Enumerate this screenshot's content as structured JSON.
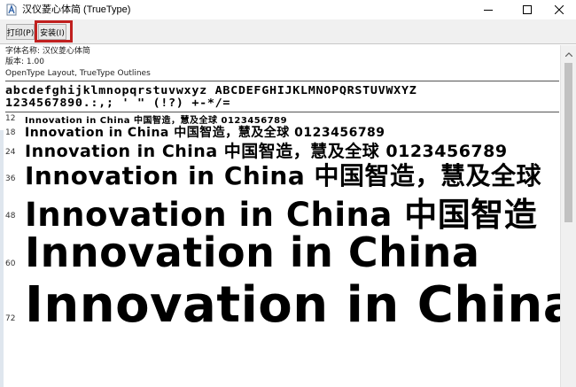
{
  "window": {
    "title": "汉仪菱心体简 (TrueType)",
    "icons": {
      "app": "font-file-icon",
      "minimize": "minimize-icon",
      "maximize": "maximize-icon",
      "close": "close-icon"
    }
  },
  "toolbar": {
    "print_label": "打印(P)",
    "install_label": "安装(I)",
    "highlight_color": "#c0201f"
  },
  "info": {
    "font_name": "字体名称: 汉仪菱心体简",
    "version": "版本: 1.00",
    "outline": "OpenType Layout, TrueType Outlines"
  },
  "charset": {
    "line1": "abcdefghijklmnopqrstuvwxyz ABCDEFGHIJKLMNOPQRSTUVWXYZ",
    "line2": "1234567890.:,; ' \" (!?) +-*/="
  },
  "samples": [
    {
      "size": "12",
      "text": "Innovation in China 中国智造，慧及全球 0123456789"
    },
    {
      "size": "18",
      "text": "Innovation in China 中国智造，慧及全球 0123456789"
    },
    {
      "size": "24",
      "text": "Innovation in China 中国智造，慧及全球 0123456789"
    },
    {
      "size": "36",
      "text": "Innovation in China 中国智造，慧及全球"
    },
    {
      "size": "48",
      "text": "Innovation in China 中国智造"
    },
    {
      "size": "60",
      "text": "Innovation in China"
    },
    {
      "size": "72",
      "text": "Innovation in China"
    }
  ],
  "scrollbar": {
    "icon": "scroll-up-arrow-icon"
  }
}
